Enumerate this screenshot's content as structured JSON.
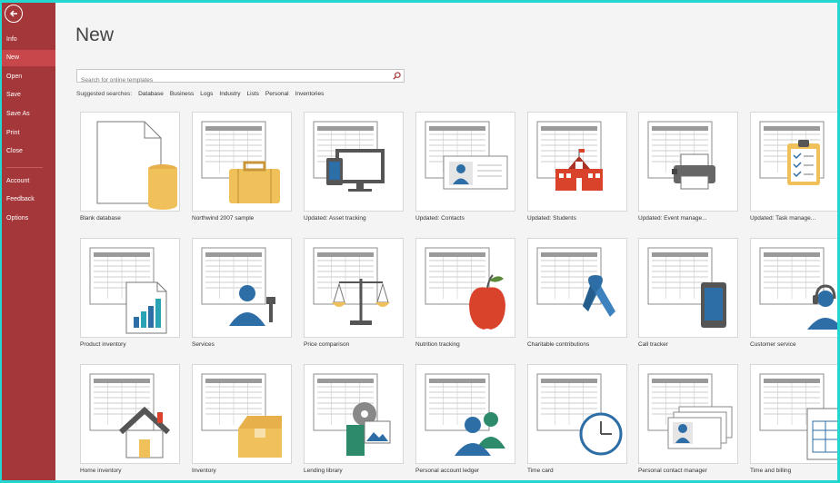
{
  "sidebar": {
    "items": [
      {
        "key": "info",
        "label": "Info"
      },
      {
        "key": "new",
        "label": "New"
      },
      {
        "key": "open",
        "label": "Open"
      },
      {
        "key": "save",
        "label": "Save"
      },
      {
        "key": "saveas",
        "label": "Save As"
      },
      {
        "key": "print",
        "label": "Print"
      },
      {
        "key": "close",
        "label": "Close"
      },
      {
        "key": "account",
        "label": "Account"
      },
      {
        "key": "feedback",
        "label": "Feedback"
      },
      {
        "key": "options",
        "label": "Options"
      }
    ],
    "active": "New"
  },
  "main": {
    "title": "New",
    "search": {
      "placeholder": "Search for online templates"
    },
    "suggested_label": "Suggested searches:",
    "suggested": [
      "Database",
      "Business",
      "Logs",
      "Industry",
      "Lists",
      "Personal",
      "Inventories"
    ]
  },
  "templates": [
    {
      "label": "Blank database",
      "icon": "blank-database-icon"
    },
    {
      "label": "Northwind 2007 sample",
      "icon": "briefcase-icon"
    },
    {
      "label": "Updated: Asset tracking",
      "icon": "devices-icon"
    },
    {
      "label": "Updated: Contacts",
      "icon": "contact-card-icon"
    },
    {
      "label": "Updated: Students",
      "icon": "school-icon"
    },
    {
      "label": "Updated: Event manage...",
      "icon": "printer-icon"
    },
    {
      "label": "Updated: Task manage...",
      "icon": "clipboard-icon"
    },
    {
      "label": "Product inventory",
      "icon": "bar-chart-icon"
    },
    {
      "label": "Services",
      "icon": "worker-icon"
    },
    {
      "label": "Price comparison",
      "icon": "scale-icon"
    },
    {
      "label": "Nutrition tracking",
      "icon": "apple-icon"
    },
    {
      "label": "Charitable contributions",
      "icon": "ribbon-icon"
    },
    {
      "label": "Call tracker",
      "icon": "phone-icon"
    },
    {
      "label": "Customer service",
      "icon": "headset-icon"
    },
    {
      "label": "Home inventory",
      "icon": "house-icon"
    },
    {
      "label": "Inventory",
      "icon": "box-icon"
    },
    {
      "label": "Lending library",
      "icon": "media-icon"
    },
    {
      "label": "Personal account ledger",
      "icon": "people-icon"
    },
    {
      "label": "Time card",
      "icon": "clock-icon"
    },
    {
      "label": "Personal contact manager",
      "icon": "contact-cards-icon"
    },
    {
      "label": "Time and billing",
      "icon": "invoice-icon"
    }
  ],
  "colors": {
    "sidebar": "#a4373a",
    "accent_gold": "#f0c05a",
    "accent_blue": "#2e6ea6",
    "accent_red": "#d9432c"
  }
}
